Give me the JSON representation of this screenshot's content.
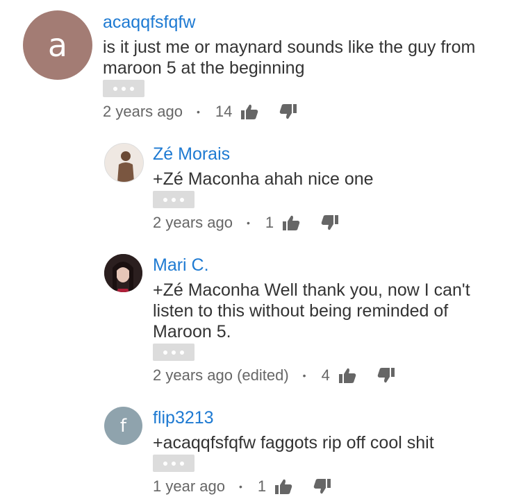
{
  "comments": [
    {
      "avatar_letter": "a",
      "avatar_color": "#a37c74",
      "author": "acaqqfsfqfw",
      "text": "is it just me or maynard sounds like the guy from maroon 5 at the beginning",
      "time": "2 years ago",
      "separator": "•",
      "likes": "14"
    },
    {
      "avatar_letter": "",
      "avatar_color": "#c8b8a8",
      "author": "Zé Morais",
      "text": "+Zé Maconha ahah nice one",
      "time": "2 years ago",
      "separator": "•",
      "likes": "1"
    },
    {
      "avatar_letter": "",
      "avatar_color": "#3a2a2a",
      "author": "Mari C.",
      "text": "+Zé Maconha Well thank you, now I can't listen to this without being reminded of Maroon 5.",
      "time": "2 years ago (edited)",
      "separator": "•",
      "likes": "4"
    },
    {
      "avatar_letter": "f",
      "avatar_color": "#8fa3ad",
      "author": "flip3213",
      "text": "+acaqqfsfqfw faggots rip off cool shit",
      "time": "1 year ago",
      "separator": "•",
      "likes": "1"
    }
  ],
  "icons": {
    "more": "more-horizontal-icon",
    "like": "thumbs-up-icon",
    "dislike": "thumbs-down-icon"
  }
}
